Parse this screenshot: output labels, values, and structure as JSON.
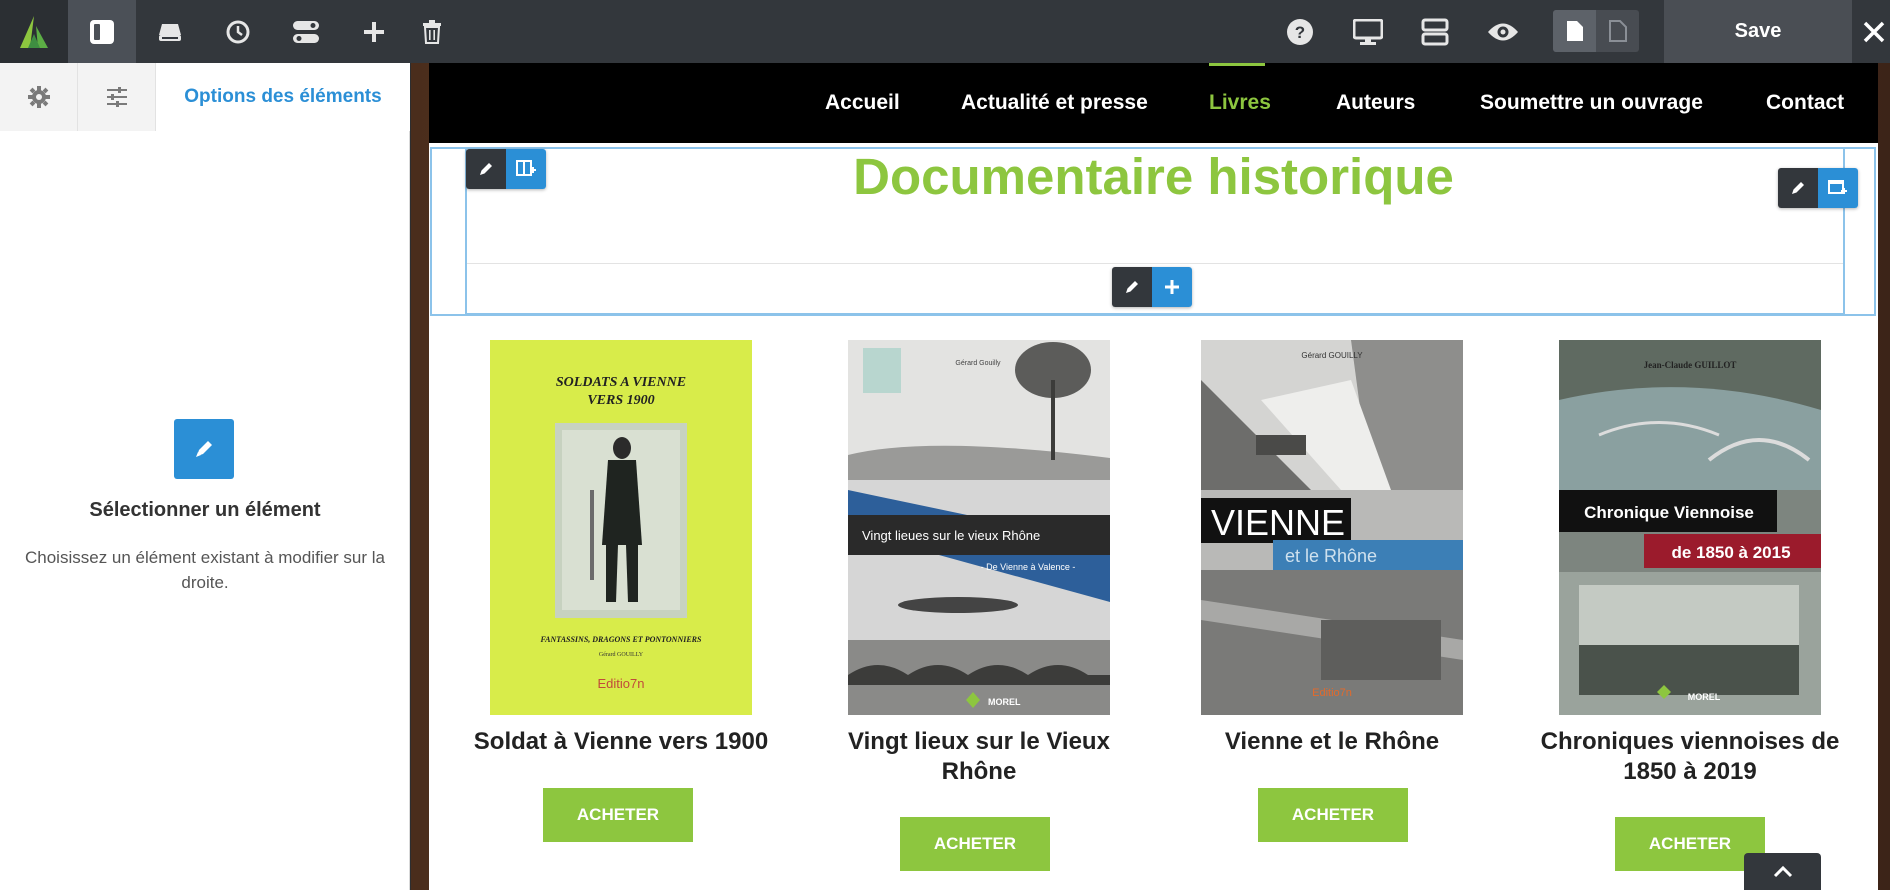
{
  "toolbar": {
    "save_label": "Save",
    "icons": [
      "logo-icon",
      "sidebar-toggle-icon",
      "layers-icon",
      "history-icon",
      "toggle-icon",
      "add-icon",
      "trash-icon",
      "help-icon",
      "desktop-icon",
      "stack-icon",
      "preview-eye-icon",
      "page-icon",
      "page-outline-icon",
      "close-icon"
    ]
  },
  "panel": {
    "tab_label": "Options des éléments",
    "select_title": "Sélectionner un élément",
    "select_description": "Choisissez un élément existant à modifier sur la droite."
  },
  "nav": {
    "items": [
      {
        "label": "Accueil"
      },
      {
        "label": "Actualité et presse"
      },
      {
        "label": "Livres"
      },
      {
        "label": "Auteurs"
      },
      {
        "label": "Soumettre un ouvrage"
      },
      {
        "label": "Contact"
      }
    ],
    "active": "Livres"
  },
  "section": {
    "heading": "Documentaire historique"
  },
  "books": [
    {
      "title": "Soldat à Vienne vers 1900",
      "buy_label": "ACHETER",
      "cover": {
        "top": "SOLDATS A VIENNE",
        "top2": "VERS 1900",
        "bottom": "FANTASSINS, DRAGONS ET PONTONNIERS",
        "author": "Gérard GOUILLY",
        "edition": "Editio7n"
      }
    },
    {
      "title": "Vingt lieux sur le Vieux Rhône",
      "buy_label": "ACHETER",
      "cover": {
        "author": "Gérard Gouilly",
        "band": "Vingt lieues sur le vieux Rhône",
        "sub": "- De Vienne à Valence -",
        "publisher": "MOREL"
      }
    },
    {
      "title": "Vienne et le Rhône",
      "buy_label": "ACHETER",
      "cover": {
        "author": "Gérard GOUILLY",
        "big": "VIENNE",
        "sub": "et le Rhône",
        "edition": "Editio7n"
      }
    },
    {
      "title": "Chroniques viennoises de 1850 à 2019",
      "buy_label": "ACHETER",
      "cover": {
        "author": "Jean-Claude GUILLOT",
        "band": "Chronique Viennoise",
        "dates": "de 1850 à 2015",
        "publisher": "MOREL"
      }
    }
  ],
  "colors": {
    "accent": "#8dc63f",
    "editor_blue": "#2b8fd6",
    "toolbar": "#33373c"
  }
}
